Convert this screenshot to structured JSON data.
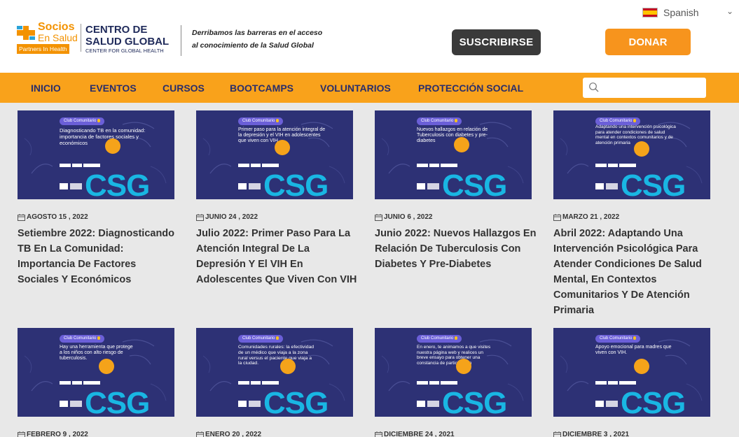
{
  "language_selector": {
    "value": "Spanish",
    "flag": "spain-flag-icon"
  },
  "brand": {
    "socios": "Socios",
    "en_salud": "En Salud",
    "partners": "Partners In Health",
    "centro_line1": "CENTRO DE",
    "centro_line2": "SALUD GLOBAL",
    "centro_line3": "CENTER FOR GLOBAL HEALTH",
    "tagline_line1": "Derribamos las barreras en el acceso",
    "tagline_line2": "al conocimiento de la Salud Global"
  },
  "header_buttons": {
    "subscribe": "SUSCRIBIRSE",
    "donate": "DONAR"
  },
  "nav": {
    "items": [
      "INICIO",
      "EVENTOS",
      "CURSOS",
      "BOOTCAMPS",
      "VOLUNTARIOS",
      "PROTECCIÓN SOCIAL"
    ],
    "search_placeholder": ""
  },
  "colors": {
    "accent": "#f9a21b",
    "navy": "#2a2e6a",
    "thumb_bg": "#2d3175",
    "csg_blue": "#19b6e3"
  },
  "posts": [
    {
      "date": "AGOSTO 15 , 2022",
      "title": "Setiembre 2022: Diagnosticando TB En La Comunidad: Importancia De Factores Sociales Y Económicos",
      "thumb_badge": "Club Comunitario",
      "thumb_text": "Diagnosticando TB en la comunidad: importancia de factores sociales y económicos",
      "thumb_logo": "CSG"
    },
    {
      "date": "JUNIO 24 , 2022",
      "title": "Julio 2022: Primer Paso Para La Atención Integral De La Depresión Y El VIH En Adolescentes Que Viven Con VIH",
      "thumb_badge": "Club Comunitario",
      "thumb_text": "Primer paso para la atención integral de la depresión y el VIH en adolescentes que viven con VIH.",
      "thumb_logo": "CSG"
    },
    {
      "date": "JUNIO 6 , 2022",
      "title": "Junio 2022: Nuevos Hallazgos En Relación De Tuberculosis Con Diabetes Y Pre-Diabetes",
      "thumb_badge": "Club Comunitario",
      "thumb_text": "Nuevos hallazgos en relación de Tuberculosis con diabetes y pre-diabetes",
      "thumb_logo": "CSG"
    },
    {
      "date": "MARZO 21 , 2022",
      "title": "Abril 2022: Adaptando Una Intervención Psicológica Para Atender Condiciones De Salud Mental, En Contextos Comunitarios Y De Atención Primaria",
      "thumb_badge": "Club Comunitario",
      "thumb_text": "Adaptando una intervención psicológica para atender condiciones de salud mental en contextos comunitarios y de atención primaria",
      "thumb_logo": "CSG"
    },
    {
      "date": "FEBRERO 9 , 2022",
      "title": "",
      "thumb_badge": "Club Comunitario",
      "thumb_text": "Hay una herramienta que protege a los niños con alto riesgo de tuberculosis.",
      "thumb_logo": "CSG"
    },
    {
      "date": "ENERO 20 , 2022",
      "title": "",
      "thumb_badge": "Club Comunitario",
      "thumb_text": "Comunidades rurales: la efectividad de un médico que viaja a la zona rural versus el paciente que viaja a la ciudad.",
      "thumb_logo": "CSG"
    },
    {
      "date": "DICIEMBRE 24 , 2021",
      "title": "",
      "thumb_badge": "Club Comunitario",
      "thumb_text": "En enero, te animamos a que visites nuestra página web y realices un breve ensayo para obtener una constancia de participación",
      "thumb_logo": "CSG"
    },
    {
      "date": "DICIEMBRE 3 , 2021",
      "title": "",
      "thumb_badge": "Club Comunitario",
      "thumb_text": "Apoyo emocional para madres que viven con VIH.",
      "thumb_logo": "CSG"
    }
  ]
}
